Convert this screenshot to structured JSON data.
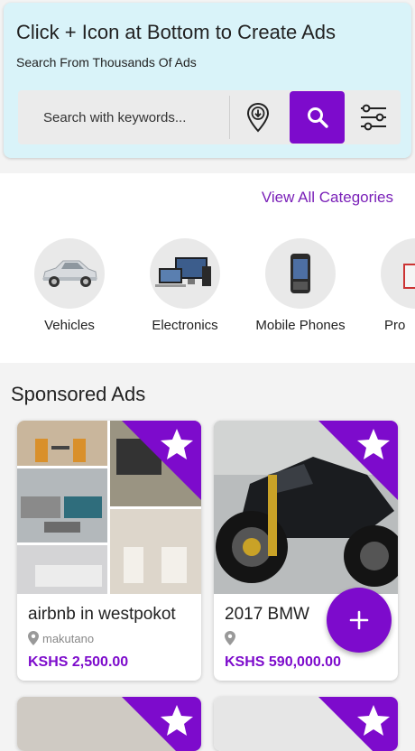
{
  "header": {
    "title": "Click + Icon at Bottom to Create Ads",
    "subtitle": "Search From Thousands Of Ads",
    "search": {
      "placeholder": "Search with keywords..."
    },
    "accent_color": "#7d0bcc"
  },
  "categories": {
    "view_all_label": "View All Categories",
    "items": [
      {
        "label": "Vehicles",
        "icon": "car-image"
      },
      {
        "label": "Electronics",
        "icon": "electronics-image"
      },
      {
        "label": "Mobile Phones",
        "icon": "mobile-phone-image"
      },
      {
        "label": "Pro",
        "icon": "property-image"
      }
    ]
  },
  "sponsored": {
    "heading": "Sponsored Ads",
    "ads": [
      {
        "title": "airbnb in westpokot",
        "location": "makutano",
        "price": "KSHS 2,500.00",
        "badge": "star-icon"
      },
      {
        "title": "2017 BMW",
        "location": "",
        "price": "KSHS 590,000.00",
        "badge": "star-icon"
      }
    ]
  },
  "fab": {
    "icon": "plus-icon"
  }
}
